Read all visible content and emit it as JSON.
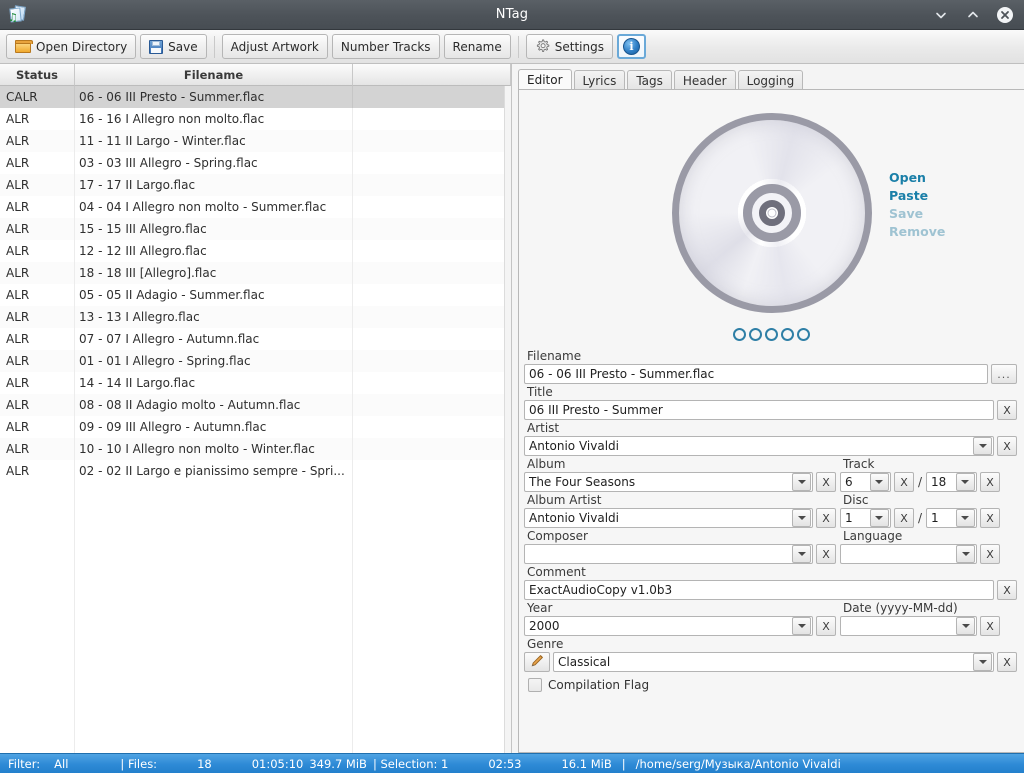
{
  "window": {
    "title": "NTag",
    "icon": "music-file-icon",
    "controls": [
      {
        "name": "minimize-button",
        "glyph": "chevron-down-icon"
      },
      {
        "name": "maximize-button",
        "glyph": "chevron-up-icon"
      },
      {
        "name": "close-button",
        "glyph": "close-icon"
      }
    ]
  },
  "toolbar": {
    "open_directory": "Open Directory",
    "save": "Save",
    "adjust_artwork": "Adjust Artwork",
    "number_tracks": "Number Tracks",
    "rename": "Rename",
    "settings": "Settings",
    "info": "i",
    "icons": {
      "open_directory": "folder-icon",
      "save": "floppy-disk-icon",
      "settings": "gear-icon",
      "info": "info-icon"
    }
  },
  "filelist": {
    "columns": [
      "Status",
      "Filename",
      ""
    ],
    "rows": [
      {
        "status": "CALR",
        "filename": "06 - 06 III Presto - Summer.flac",
        "selected": true
      },
      {
        "status": "ALR",
        "filename": "16 - 16 I Allegro non molto.flac",
        "selected": false
      },
      {
        "status": "ALR",
        "filename": "11 - 11 II Largo - Winter.flac",
        "selected": false
      },
      {
        "status": "ALR",
        "filename": "03 - 03 III Allegro - Spring.flac",
        "selected": false
      },
      {
        "status": "ALR",
        "filename": "17 - 17 II Largo.flac",
        "selected": false
      },
      {
        "status": "ALR",
        "filename": "04 - 04 I Allegro non molto - Summer.flac",
        "selected": false
      },
      {
        "status": "ALR",
        "filename": "15 - 15 III Allegro.flac",
        "selected": false
      },
      {
        "status": "ALR",
        "filename": "12 - 12 III Allegro.flac",
        "selected": false
      },
      {
        "status": "ALR",
        "filename": "18 - 18 III [Allegro].flac",
        "selected": false
      },
      {
        "status": "ALR",
        "filename": "05 - 05 II Adagio - Summer.flac",
        "selected": false
      },
      {
        "status": "ALR",
        "filename": "13 - 13 I Allegro.flac",
        "selected": false
      },
      {
        "status": "ALR",
        "filename": "07 - 07 I Allegro - Autumn.flac",
        "selected": false
      },
      {
        "status": "ALR",
        "filename": "01 - 01 I Allegro - Spring.flac",
        "selected": false
      },
      {
        "status": "ALR",
        "filename": "14 - 14 II Largo.flac",
        "selected": false
      },
      {
        "status": "ALR",
        "filename": "08 - 08 II Adagio molto - Autumn.flac",
        "selected": false
      },
      {
        "status": "ALR",
        "filename": "09 - 09 III Allegro - Autumn.flac",
        "selected": false
      },
      {
        "status": "ALR",
        "filename": "10 - 10 I Allegro non molto - Winter.flac",
        "selected": false
      },
      {
        "status": "ALR",
        "filename": "02 - 02 II Largo e pianissimo sempre - Spri...",
        "selected": false
      }
    ]
  },
  "tabs": [
    {
      "label": "Editor",
      "active": true
    },
    {
      "label": "Lyrics",
      "active": false
    },
    {
      "label": "Tags",
      "active": false
    },
    {
      "label": "Header",
      "active": false
    },
    {
      "label": "Logging",
      "active": false
    }
  ],
  "artwork": {
    "icon": "cd-disc-icon",
    "actions": [
      {
        "label": "Open",
        "enabled": true
      },
      {
        "label": "Paste",
        "enabled": true
      },
      {
        "label": "Save",
        "enabled": false
      },
      {
        "label": "Remove",
        "enabled": false
      }
    ],
    "page_dots": 5,
    "accent_color": "#1a7fa8",
    "disabled_color": "#9fc3d2"
  },
  "editor": {
    "filename": {
      "label": "Filename",
      "value": "06 - 06 III Presto - Summer.flac",
      "browse": "..."
    },
    "title": {
      "label": "Title",
      "value": "06 III Presto - Summer",
      "clear": "X"
    },
    "artist": {
      "label": "Artist",
      "value": "Antonio Vivaldi",
      "clear": "X"
    },
    "album": {
      "label": "Album",
      "value": "The Four Seasons",
      "clear": "X"
    },
    "track": {
      "label": "Track",
      "value": "6",
      "total": "18",
      "clear": "X",
      "clear_total": "X",
      "separator": "/"
    },
    "album_artist": {
      "label": "Album Artist",
      "value": "Antonio Vivaldi",
      "clear": "X"
    },
    "disc": {
      "label": "Disc",
      "value": "1",
      "total": "1",
      "clear": "X",
      "clear_total": "X",
      "separator": "/"
    },
    "composer": {
      "label": "Composer",
      "value": "",
      "clear": "X"
    },
    "language": {
      "label": "Language",
      "value": "",
      "clear": "X"
    },
    "comment": {
      "label": "Comment",
      "value": "ExactAudioCopy v1.0b3",
      "clear": "X"
    },
    "year": {
      "label": "Year",
      "value": "2000",
      "clear": "X"
    },
    "date": {
      "label": "Date (yyyy-MM-dd)",
      "value": "",
      "clear": "X"
    },
    "genre": {
      "label": "Genre",
      "value": "Classical",
      "clear": "X",
      "edit_icon": "pencil-icon"
    },
    "compilation": {
      "label": "Compilation Flag",
      "checked": false
    }
  },
  "statusbar": {
    "filter_label": "Filter:",
    "filter_value": "All",
    "files_label": "| Files:",
    "files_count": "18",
    "total_duration": "01:05:10",
    "total_size": "349.7 MiB",
    "selection_label": "| Selection: 1",
    "selection_duration": "02:53",
    "selection_size": "16.1 MiB",
    "path_separator": "|",
    "path": "/home/serg/Музыка/Antonio Vivaldi",
    "background_color": "#2e8ad6"
  }
}
